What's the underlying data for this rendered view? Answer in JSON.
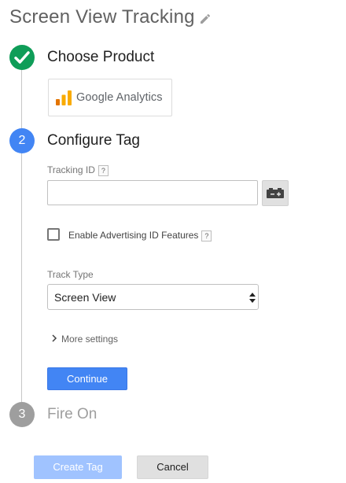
{
  "header": {
    "title": "Screen View Tracking",
    "edit_icon": "pencil-icon"
  },
  "steps": [
    {
      "number": "",
      "title": "Choose Product",
      "state": "complete",
      "icon": "check-icon",
      "color": "#0f9d58"
    },
    {
      "number": "2",
      "title": "Configure Tag",
      "state": "active",
      "color": "#4285f4"
    },
    {
      "number": "3",
      "title": "Fire On",
      "state": "pending",
      "color": "#9e9e9e"
    }
  ],
  "product": {
    "name": "Google Analytics",
    "logo": "google-analytics-logo-icon"
  },
  "tracking_id": {
    "label": "Tracking ID",
    "help": "?",
    "value": "",
    "placeholder": "",
    "variable_icon": "variable-picker-icon"
  },
  "advertising": {
    "label": "Enable Advertising ID Features",
    "help": "?",
    "checked": false
  },
  "track_type": {
    "label": "Track Type",
    "selected": "Screen View"
  },
  "more_settings": {
    "label": "More settings",
    "icon": "chevron-right-icon"
  },
  "buttons": {
    "continue": "Continue",
    "create_tag": "Create Tag",
    "cancel": "Cancel"
  },
  "colors": {
    "primary": "#4285f4",
    "success": "#0f9d58",
    "disabled_primary": "#a0c3ff",
    "ga_orange": "#f9ab00",
    "ga_dark_orange": "#e37400"
  }
}
